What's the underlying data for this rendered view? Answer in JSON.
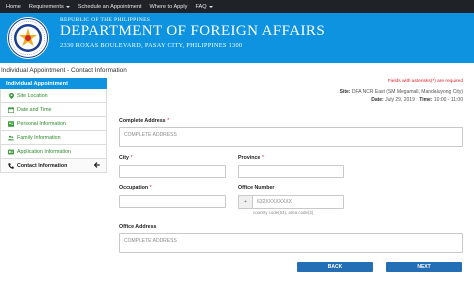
{
  "topnav": {
    "items": [
      {
        "label": "Home",
        "has_caret": false
      },
      {
        "label": "Requirements",
        "has_caret": true
      },
      {
        "label": "Schedule an Appointment",
        "has_caret": false
      },
      {
        "label": "Where to Apply",
        "has_caret": false
      },
      {
        "label": "FAQ",
        "has_caret": true
      }
    ]
  },
  "banner": {
    "republic": "REPUBLIC OF THE PHILIPPINES",
    "department": "DEPARTMENT OF FOREIGN AFFAIRS",
    "address": "2330 ROXAS BOULEVARD, PASAY CITY, PHILIPPINES 1300",
    "color": "#0d93e0"
  },
  "page_title": "Individual Appointment - Contact Information",
  "sidebar": {
    "header": "Individual Appointment",
    "items": [
      {
        "label": "Site Location",
        "icon": "map-marker-icon"
      },
      {
        "label": "Date and Time",
        "icon": "calendar-icon"
      },
      {
        "label": "Personal Information",
        "icon": "user-icon"
      },
      {
        "label": "Family Information",
        "icon": "users-icon"
      },
      {
        "label": "Application Information",
        "icon": "id-card-icon"
      },
      {
        "label": "Contact Information",
        "icon": "phone-icon",
        "active": true
      }
    ]
  },
  "required_note": "Fields with asterisks(*) are required",
  "site": {
    "label": "Site:",
    "value": "DFA NCR East (SM Megamall, Mandaluyong City)"
  },
  "date": {
    "label": "Date:",
    "value": "July 29, 2019",
    "time_label": "Time:",
    "time_value": "10:00 - 11:00"
  },
  "form": {
    "complete_address": {
      "label": "Complete Address",
      "required": "*",
      "placeholder": "COMPLETE ADDRESS"
    },
    "city": {
      "label": "City",
      "required": "*",
      "value": ""
    },
    "province": {
      "label": "Province",
      "required": "*",
      "value": ""
    },
    "occupation": {
      "label": "Occupation",
      "required": "*",
      "value": ""
    },
    "office_number": {
      "label": "Office Number",
      "prefix": "+",
      "placeholder": "632XXXXXXXX",
      "hint": "country code(63), area code(2)"
    },
    "office_address": {
      "label": "Office Address",
      "placeholder": "COMPLETE ADDRESS"
    }
  },
  "buttons": {
    "back": "BACK",
    "next": "NEXT"
  },
  "colors": {
    "accent": "#0d93e0",
    "button": "#236eb5",
    "required": "#d9242b",
    "sidebar_link": "#2e8b2e"
  }
}
